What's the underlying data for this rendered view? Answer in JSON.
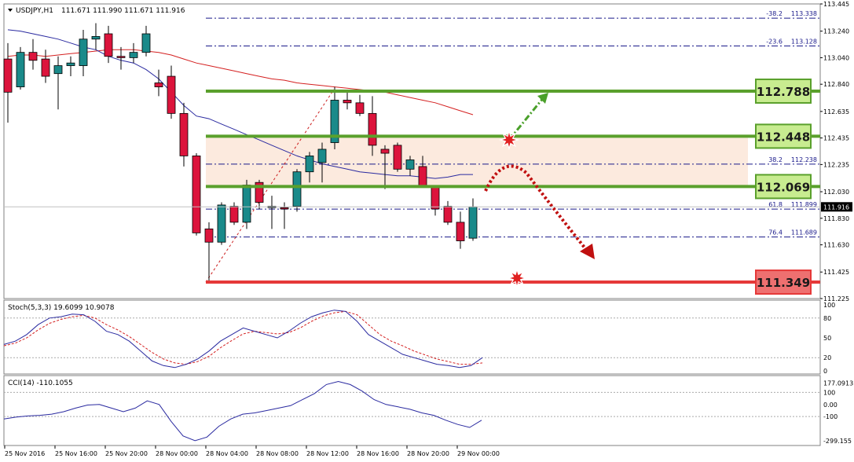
{
  "header": {
    "symbol": "USDJPY,H1",
    "ohlc": "111.671 111.990 111.671 111.916"
  },
  "colors": {
    "bull": "#1a8a8a",
    "bear": "#dc143c",
    "ma_fast": "#2a2aa0",
    "ma_slow": "#d42020",
    "level_green": "#5aa02c",
    "level_red": "#e53838",
    "zone": "#fbe6d8",
    "fib": "#1a1a8a"
  },
  "chart_data": [
    {
      "type": "candlestick",
      "title": "USDJPY,H1",
      "ylim": [
        111.225,
        113.445
      ],
      "y_ticks": [
        "113.445",
        "113.240",
        "113.040",
        "112.840",
        "112.635",
        "112.435",
        "112.235",
        "112.030",
        "111.830",
        "111.630",
        "111.425",
        "111.225"
      ],
      "x_ticks": [
        "25 Nov 2016",
        "25 Nov 16:00",
        "25 Nov 20:00",
        "28 Nov 00:00",
        "28 Nov 04:00",
        "28 Nov 08:00",
        "28 Nov 12:00",
        "28 Nov 16:00",
        "28 Nov 20:00",
        "29 Nov 00:00"
      ],
      "current_price": "111.916",
      "candles": [
        {
          "o": 113.03,
          "h": 113.15,
          "l": 112.55,
          "c": 112.78
        },
        {
          "o": 112.82,
          "h": 113.12,
          "l": 112.8,
          "c": 113.08
        },
        {
          "o": 113.08,
          "h": 113.18,
          "l": 112.95,
          "c": 113.02
        },
        {
          "o": 113.03,
          "h": 113.1,
          "l": 112.85,
          "c": 112.9
        },
        {
          "o": 112.92,
          "h": 113.05,
          "l": 112.65,
          "c": 112.98
        },
        {
          "o": 112.98,
          "h": 113.05,
          "l": 112.9,
          "c": 113.0
        },
        {
          "o": 112.98,
          "h": 113.25,
          "l": 112.9,
          "c": 113.18
        },
        {
          "o": 113.18,
          "h": 113.3,
          "l": 113.1,
          "c": 113.2
        },
        {
          "o": 113.22,
          "h": 113.28,
          "l": 113.0,
          "c": 113.05
        },
        {
          "o": 113.05,
          "h": 113.12,
          "l": 112.95,
          "c": 113.04
        },
        {
          "o": 113.04,
          "h": 113.15,
          "l": 113.0,
          "c": 113.08
        },
        {
          "o": 113.08,
          "h": 113.28,
          "l": 113.05,
          "c": 113.22
        },
        {
          "o": 112.85,
          "h": 112.95,
          "l": 112.75,
          "c": 112.82
        },
        {
          "o": 112.9,
          "h": 112.98,
          "l": 112.58,
          "c": 112.62
        },
        {
          "o": 112.62,
          "h": 112.7,
          "l": 112.22,
          "c": 112.3
        },
        {
          "o": 112.3,
          "h": 112.32,
          "l": 111.7,
          "c": 111.72
        },
        {
          "o": 111.75,
          "h": 111.8,
          "l": 111.35,
          "c": 111.65
        },
        {
          "o": 111.65,
          "h": 111.95,
          "l": 111.63,
          "c": 111.93
        },
        {
          "o": 111.92,
          "h": 111.95,
          "l": 111.78,
          "c": 111.8
        },
        {
          "o": 111.8,
          "h": 112.12,
          "l": 111.75,
          "c": 112.08
        },
        {
          "o": 112.1,
          "h": 112.12,
          "l": 111.9,
          "c": 111.95
        },
        {
          "o": 111.91,
          "h": 112.0,
          "l": 111.75,
          "c": 111.92
        },
        {
          "o": 111.91,
          "h": 111.95,
          "l": 111.75,
          "c": 111.9
        },
        {
          "o": 111.92,
          "h": 112.2,
          "l": 111.88,
          "c": 112.18
        },
        {
          "o": 112.18,
          "h": 112.33,
          "l": 112.1,
          "c": 112.3
        },
        {
          "o": 112.25,
          "h": 112.4,
          "l": 112.1,
          "c": 112.35
        },
        {
          "o": 112.4,
          "h": 112.82,
          "l": 112.35,
          "c": 112.72
        },
        {
          "o": 112.72,
          "h": 112.78,
          "l": 112.65,
          "c": 112.7
        },
        {
          "o": 112.7,
          "h": 112.76,
          "l": 112.6,
          "c": 112.62
        },
        {
          "o": 112.62,
          "h": 112.75,
          "l": 112.3,
          "c": 112.38
        },
        {
          "o": 112.35,
          "h": 112.38,
          "l": 112.05,
          "c": 112.32
        },
        {
          "o": 112.38,
          "h": 112.4,
          "l": 112.18,
          "c": 112.2
        },
        {
          "o": 112.2,
          "h": 112.3,
          "l": 112.15,
          "c": 112.27
        },
        {
          "o": 112.22,
          "h": 112.3,
          "l": 112.06,
          "c": 112.07
        },
        {
          "o": 112.07,
          "h": 112.08,
          "l": 111.85,
          "c": 111.9
        },
        {
          "o": 111.92,
          "h": 111.96,
          "l": 111.78,
          "c": 111.8
        },
        {
          "o": 111.8,
          "h": 111.88,
          "l": 111.6,
          "c": 111.66
        },
        {
          "o": 111.68,
          "h": 111.98,
          "l": 111.66,
          "c": 111.916
        }
      ],
      "ma_fast": [
        113.25,
        113.24,
        113.22,
        113.2,
        113.18,
        113.15,
        113.12,
        113.1,
        113.05,
        113.02,
        113.0,
        112.95,
        112.88,
        112.78,
        112.68,
        112.6,
        112.58,
        112.54,
        112.5,
        112.46,
        112.42,
        112.38,
        112.34,
        112.3,
        112.27,
        112.24,
        112.22,
        112.2,
        112.18,
        112.17,
        112.16,
        112.15,
        112.15,
        112.14,
        112.13,
        112.14,
        112.16,
        112.16
      ],
      "ma_slow": [
        113.05,
        113.06,
        113.06,
        113.05,
        113.06,
        113.07,
        113.08,
        113.09,
        113.1,
        113.1,
        113.1,
        113.09,
        113.08,
        113.06,
        113.03,
        113.0,
        112.98,
        112.96,
        112.94,
        112.92,
        112.9,
        112.88,
        112.87,
        112.85,
        112.84,
        112.83,
        112.82,
        112.81,
        112.8,
        112.79,
        112.78,
        112.76,
        112.74,
        112.72,
        112.7,
        112.67,
        112.64,
        112.61
      ],
      "levels": [
        {
          "value": 112.788,
          "label": "112.788",
          "color": "green"
        },
        {
          "value": 112.448,
          "label": "112.448",
          "color": "green"
        },
        {
          "value": 112.069,
          "label": "112.069",
          "color": "green"
        },
        {
          "value": 111.349,
          "label": "111.349",
          "color": "red"
        }
      ],
      "fib_levels": [
        {
          "pct": "-38.2",
          "value": 113.338,
          "label": "113.338"
        },
        {
          "pct": "-23.6",
          "value": 113.128,
          "label": "113.128"
        },
        {
          "pct": "38.2",
          "value": 112.238,
          "label": "112.238"
        },
        {
          "pct": "61.8",
          "value": 111.899,
          "label": "111.899"
        },
        {
          "pct": "76.4",
          "value": 111.689,
          "label": "111.689"
        }
      ],
      "zone": {
        "from": 112.069,
        "to": 112.448
      }
    },
    {
      "type": "line",
      "title": "Stoch(5,3,3) 19.6099 10.9078",
      "ylim": [
        0,
        100
      ],
      "y_ticks": [
        "100",
        "80",
        "50",
        "20",
        "0"
      ],
      "main": [
        40,
        45,
        55,
        70,
        80,
        82,
        86,
        85,
        75,
        60,
        55,
        45,
        30,
        15,
        8,
        5,
        10,
        18,
        30,
        45,
        55,
        65,
        60,
        55,
        50,
        60,
        72,
        82,
        88,
        92,
        90,
        75,
        55,
        45,
        35,
        25,
        20,
        15,
        10,
        8,
        5,
        8,
        20
      ],
      "signal": [
        38,
        42,
        50,
        62,
        72,
        78,
        82,
        84,
        80,
        70,
        62,
        52,
        40,
        28,
        18,
        12,
        10,
        14,
        22,
        35,
        46,
        56,
        60,
        58,
        56,
        58,
        65,
        75,
        83,
        88,
        90,
        85,
        70,
        55,
        45,
        38,
        30,
        24,
        18,
        14,
        10,
        10,
        12
      ]
    },
    {
      "type": "line",
      "title": "CCI(14) -110.1055",
      "ylim": [
        -320,
        200
      ],
      "y_ticks": [
        "177.0913",
        "100",
        "0.00",
        "-100",
        "-299.155"
      ],
      "values": [
        -120,
        -105,
        -95,
        -90,
        -80,
        -60,
        -30,
        -5,
        0,
        -30,
        -60,
        -30,
        30,
        0,
        -140,
        -260,
        -300,
        -270,
        -180,
        -120,
        -80,
        -70,
        -50,
        -30,
        -10,
        40,
        90,
        165,
        190,
        165,
        110,
        40,
        0,
        -20,
        -40,
        -70,
        -90,
        -130,
        -165,
        -190,
        -130
      ]
    }
  ]
}
